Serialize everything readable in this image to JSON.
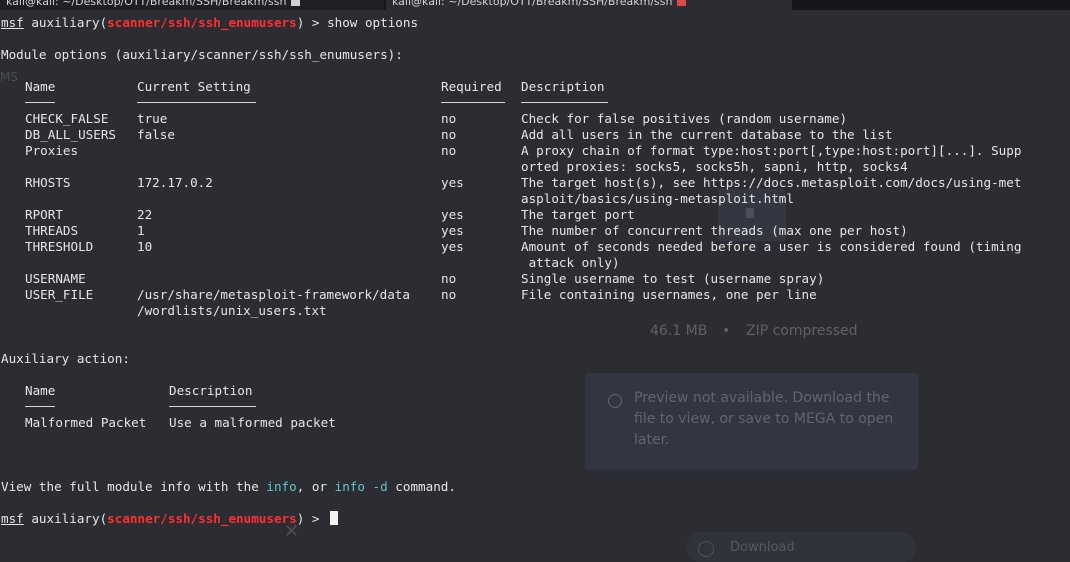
{
  "tabs": [
    {
      "label": "kali@kali: ~/Desktop/OTT/Breakm/SSH/Breakm/ssh"
    },
    {
      "label": "kali@kali: ~/Desktop/OTT/Breakm/SSH/Breakm/ssh"
    }
  ],
  "prompt": {
    "msf": "msf",
    "module_prefix": " auxiliary(",
    "module_path": "scanner/ssh/ssh_enumusers",
    "module_suffix": ") > ",
    "command": "show options"
  },
  "module_options_heading": "Module options (auxiliary/scanner/ssh/ssh_enumusers):",
  "options_table": {
    "headers": {
      "name": "Name",
      "current": "Current Setting",
      "required": "Required",
      "description": "Description"
    },
    "rows": [
      {
        "name": "CHECK_FALSE",
        "current": "true",
        "required": "no",
        "description": [
          "Check for false positives (random username)"
        ]
      },
      {
        "name": "DB_ALL_USERS",
        "current": "false",
        "required": "no",
        "description": [
          "Add all users in the current database to the list"
        ]
      },
      {
        "name": "Proxies",
        "current": "",
        "required": "no",
        "description": [
          "A proxy chain of format type:host:port[,type:host:port][...]. Supp",
          "orted proxies: socks5, socks5h, sapni, http, socks4"
        ]
      },
      {
        "name": "RHOSTS",
        "current": "172.17.0.2",
        "required": "yes",
        "description": [
          "The target host(s), see https://docs.metasploit.com/docs/using-met",
          "asploit/basics/using-metasploit.html"
        ]
      },
      {
        "name": "RPORT",
        "current": "22",
        "required": "yes",
        "description": [
          "The target port"
        ]
      },
      {
        "name": "THREADS",
        "current": "1",
        "required": "yes",
        "description": [
          "The number of concurrent threads (max one per host)"
        ]
      },
      {
        "name": "THRESHOLD",
        "current": "10",
        "required": "yes",
        "description": [
          "Amount of seconds needed before a user is considered found (timing",
          " attack only)"
        ]
      },
      {
        "name": "USERNAME",
        "current": "",
        "required": "no",
        "description": [
          "Single username to test (username spray)"
        ]
      },
      {
        "name": "USER_FILE",
        "current": [
          "/usr/share/metasploit-framework/data",
          "/wordlists/unix_users.txt"
        ],
        "required": "no",
        "description": [
          "File containing usernames, one per line"
        ]
      }
    ]
  },
  "aux_action_heading": "Auxiliary action:",
  "action_table": {
    "headers": {
      "name": "Name",
      "description": "Description"
    },
    "rows": [
      {
        "name": "Malformed Packet",
        "description": "Use a malformed packet"
      }
    ]
  },
  "info_line": {
    "before": "View the full module info with the ",
    "info": "info",
    "middle": ", or ",
    "info_d": "info -d",
    "after": " command."
  },
  "background_overlay": {
    "m_label": "MS",
    "size_text": "46.1 MB",
    "dot": "•",
    "compressed_text": "ZIP compressed",
    "preview_text": "Preview not available. Download the file to view, or save to MEGA to open later.",
    "close_glyph": "✕",
    "bottom_text": "Download"
  },
  "colors": {
    "background": "#2b2d33",
    "module_red": "#ff2f2f",
    "keyword_cyan": "#5fc7c7"
  }
}
